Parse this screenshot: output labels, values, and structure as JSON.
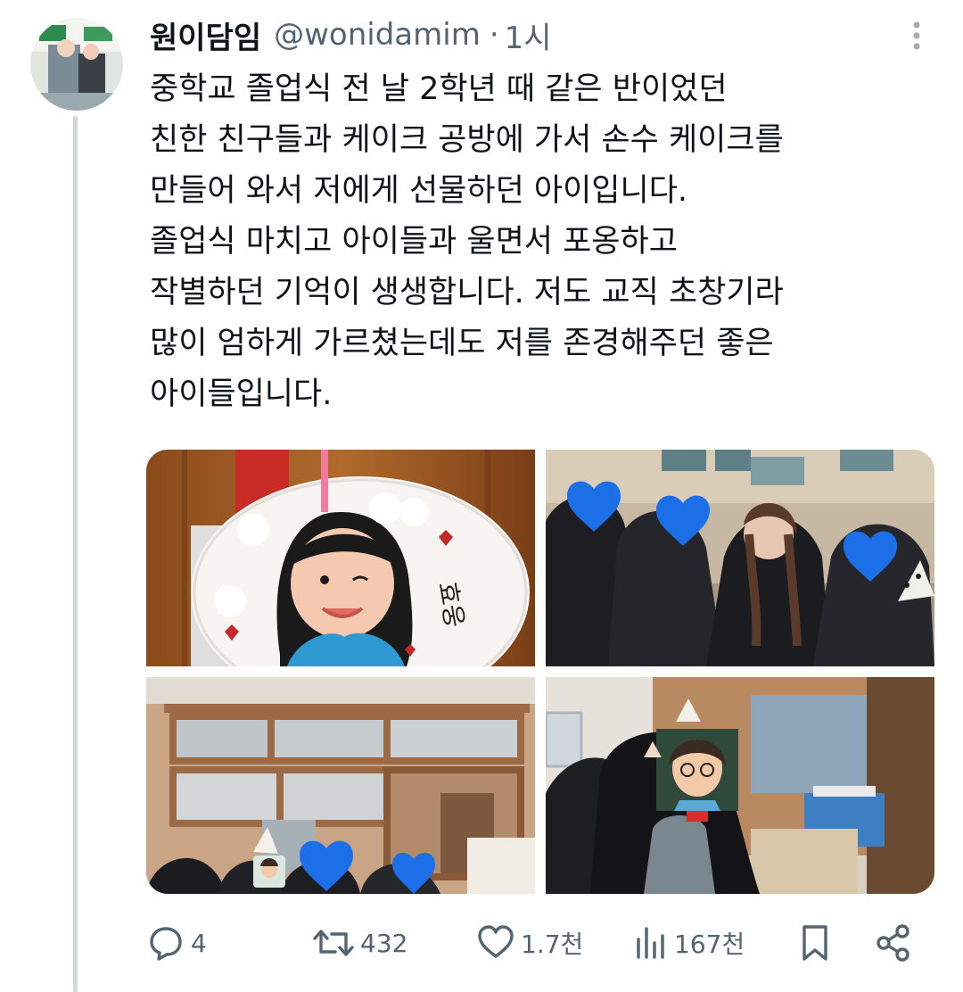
{
  "tweet": {
    "display_name": "원이담임",
    "handle": "@wonidamim",
    "separator": "·",
    "time": "1시",
    "text_lines": [
      "중학교 졸업식 전 날 2학년 때 같은 반이었던",
      "친한 친구들과 케이크 공방에 가서 손수 케이크를",
      "만들어 와서 저에게 선물하던 아이입니다.",
      "졸업식 마치고 아이들과 울면서 포옹하고",
      "작별하던 기억이 생생합니다. 저도 교직 초창기라",
      "많이 엄하게 가르쳤는데도 저를 존경해주던 좋은",
      "아이들입니다."
    ]
  },
  "media": {
    "cake_text": "효웅"
  },
  "actions": {
    "reply_count": "4",
    "retweet_count": "432",
    "like_count": "1.7천",
    "view_count": "167천"
  },
  "icons": {
    "more": "more-vertical-icon",
    "reply": "reply-icon",
    "retweet": "retweet-icon",
    "like": "heart-icon",
    "views": "views-icon",
    "bookmark": "bookmark-icon",
    "share": "share-icon"
  },
  "colors": {
    "text_primary": "#0f1419",
    "text_secondary": "#536471",
    "thread_line": "#cfd9de",
    "heart_emoji": "#1d6fe8"
  }
}
